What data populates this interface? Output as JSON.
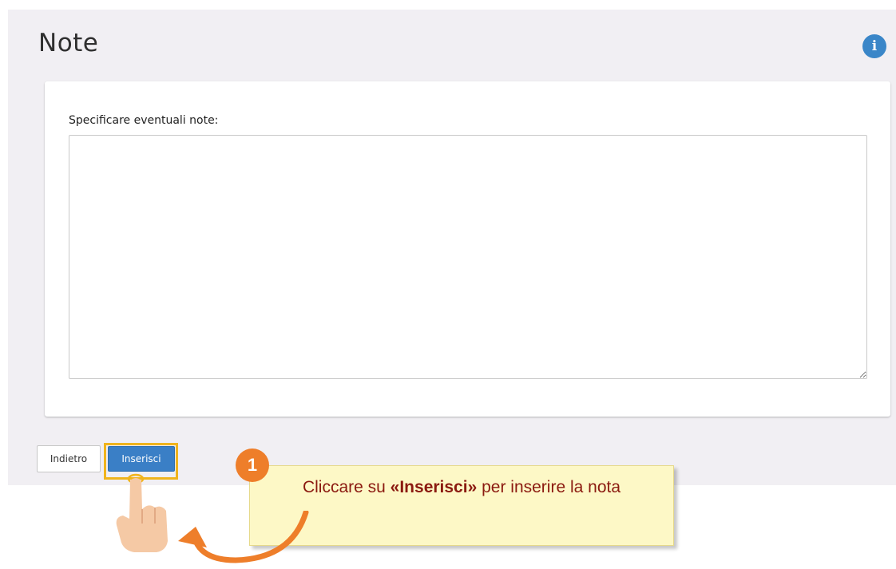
{
  "page": {
    "title": "Note"
  },
  "form": {
    "notes_label": "Specificare eventuali note:",
    "notes_value": ""
  },
  "actions": {
    "back_label": "Indietro",
    "insert_label": "Inserisci"
  },
  "tutorial": {
    "step_number": "1",
    "callout_pre": "Cliccare su ",
    "callout_bold": "«Inserisci»",
    "callout_post": " per inserire la nota"
  },
  "icons": {
    "info": "info-icon",
    "hand": "hand-pointer-icon",
    "arrow": "curved-arrow-icon"
  },
  "colors": {
    "accent": "#3a7fc6",
    "highlight": "#f0b41c",
    "badge": "#ee7e2a",
    "callout_bg": "#fdf8c6",
    "callout_text": "#8b1a10"
  }
}
